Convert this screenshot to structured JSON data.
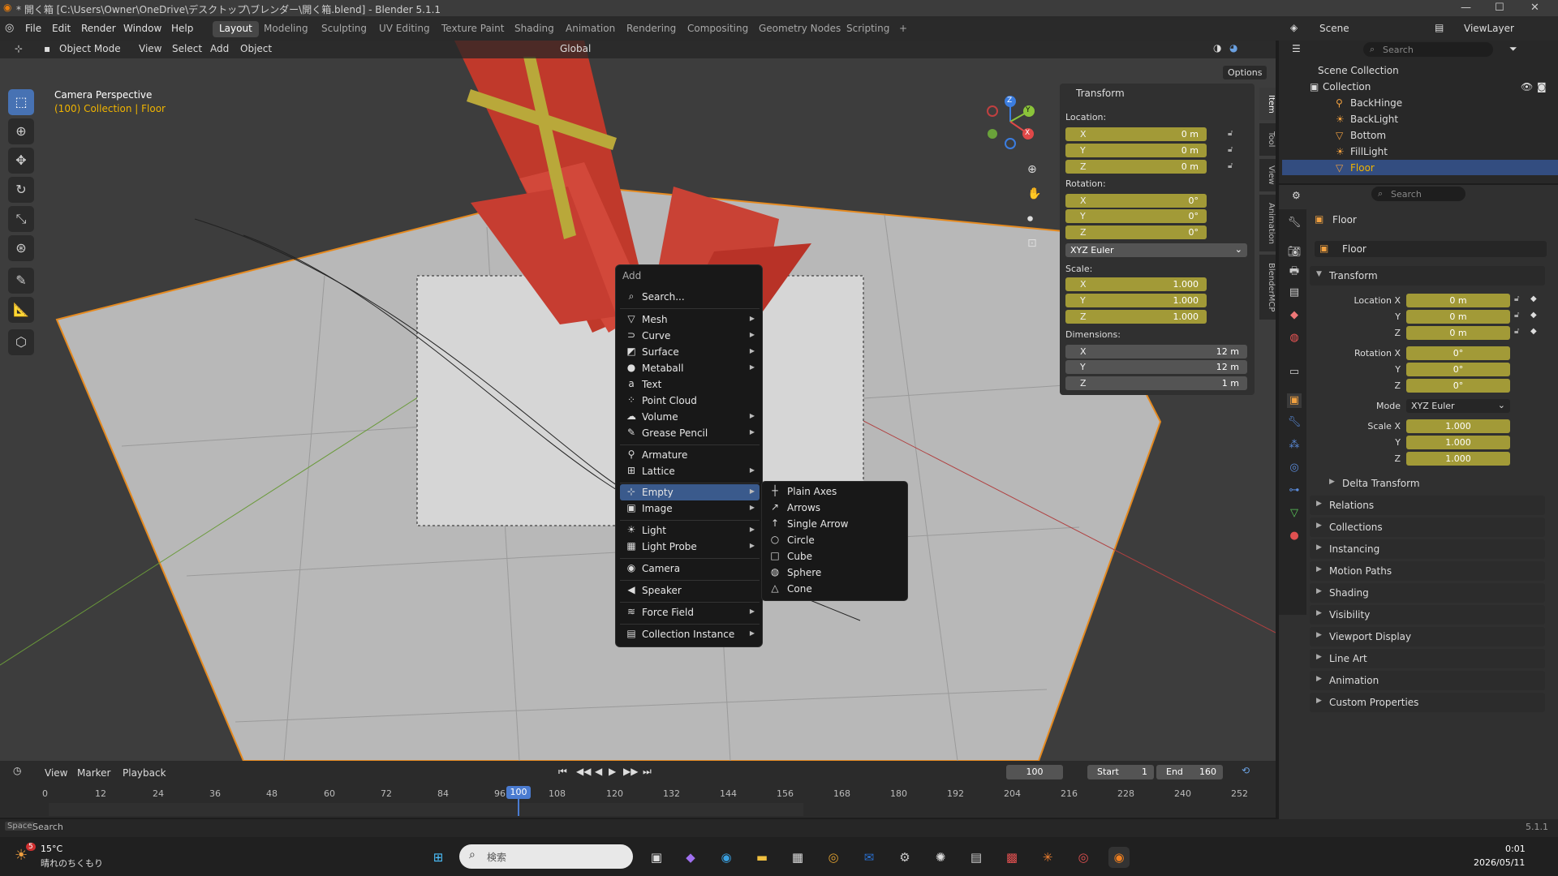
{
  "window": {
    "title": "* 開く箱 [C:\\Users\\Owner\\OneDrive\\デスクトップ\\ブレンダー\\開く箱.blend] - Blender 5.1.1",
    "minimize": "—",
    "maximize": "☐",
    "close": "✕"
  },
  "menubar": {
    "items": [
      "File",
      "Edit",
      "Render",
      "Window",
      "Help"
    ]
  },
  "workspaces": {
    "tabs": [
      "Layout",
      "Modeling",
      "Sculpting",
      "UV Editing",
      "Texture Paint",
      "Shading",
      "Animation",
      "Rendering",
      "Compositing",
      "Geometry Nodes",
      "Scripting"
    ],
    "active": "Layout",
    "add": "+"
  },
  "scene": {
    "label": "Scene",
    "viewlayer": "ViewLayer"
  },
  "viewport": {
    "mode": "Object Mode",
    "menus": [
      "View",
      "Select",
      "Add",
      "Object"
    ],
    "orientation": "Global",
    "options": "Options",
    "camera_title": "Camera Perspective",
    "collection_info": "(100) Collection | Floor",
    "gizmo": {
      "x": "X",
      "y": "Y",
      "z": "Z"
    }
  },
  "npanel": {
    "header": "Transform",
    "location_label": "Location:",
    "location": [
      {
        "axis": "X",
        "value": "0 m"
      },
      {
        "axis": "Y",
        "value": "0 m"
      },
      {
        "axis": "Z",
        "value": "0 m"
      }
    ],
    "rotation_label": "Rotation:",
    "rotation": [
      {
        "axis": "X",
        "value": "0°"
      },
      {
        "axis": "Y",
        "value": "0°"
      },
      {
        "axis": "Z",
        "value": "0°"
      }
    ],
    "rotation_mode": "XYZ Euler",
    "scale_label": "Scale:",
    "scale": [
      {
        "axis": "X",
        "value": "1.000"
      },
      {
        "axis": "Y",
        "value": "1.000"
      },
      {
        "axis": "Z",
        "value": "1.000"
      }
    ],
    "dimensions_label": "Dimensions:",
    "dimensions": [
      {
        "axis": "X",
        "value": "12 m"
      },
      {
        "axis": "Y",
        "value": "12 m"
      },
      {
        "axis": "Z",
        "value": "1 m"
      }
    ],
    "tabs": [
      "Item",
      "Tool",
      "View",
      "Animation",
      "BlenderMCP"
    ]
  },
  "add_menu": {
    "title": "Add",
    "search": "Search...",
    "items": [
      {
        "label": "Mesh",
        "icon": "▽",
        "sub": true
      },
      {
        "label": "Curve",
        "icon": "⊃",
        "sub": true
      },
      {
        "label": "Surface",
        "icon": "◩",
        "sub": true
      },
      {
        "label": "Metaball",
        "icon": "●",
        "sub": true
      },
      {
        "label": "Text",
        "icon": "a",
        "sub": false
      },
      {
        "label": "Point Cloud",
        "icon": "⁘",
        "sub": false
      },
      {
        "label": "Volume",
        "icon": "☁",
        "sub": true
      },
      {
        "label": "Grease Pencil",
        "icon": "✎",
        "sub": true
      },
      {
        "label": "Armature",
        "icon": "⚲",
        "sub": false
      },
      {
        "label": "Lattice",
        "icon": "⊞",
        "sub": true
      },
      {
        "label": "Empty",
        "icon": "⊹",
        "sub": true
      },
      {
        "label": "Image",
        "icon": "▣",
        "sub": true
      },
      {
        "label": "Light",
        "icon": "☀",
        "sub": true
      },
      {
        "label": "Light Probe",
        "icon": "▦",
        "sub": true
      },
      {
        "label": "Camera",
        "icon": "◉",
        "sub": false
      },
      {
        "label": "Speaker",
        "icon": "◀",
        "sub": false
      },
      {
        "label": "Force Field",
        "icon": "≋",
        "sub": true
      },
      {
        "label": "Collection Instance",
        "icon": "▤",
        "sub": true
      }
    ],
    "highlighted": "Empty"
  },
  "empty_submenu": {
    "items": [
      {
        "label": "Plain Axes",
        "icon": "┼"
      },
      {
        "label": "Arrows",
        "icon": "↗"
      },
      {
        "label": "Single Arrow",
        "icon": "↑"
      },
      {
        "label": "Circle",
        "icon": "○"
      },
      {
        "label": "Cube",
        "icon": "□"
      },
      {
        "label": "Sphere",
        "icon": "◍"
      },
      {
        "label": "Cone",
        "icon": "△"
      }
    ]
  },
  "outliner": {
    "search": "Search",
    "root": "Scene Collection",
    "collection": "Collection",
    "items": [
      "BackHinge",
      "BackLight",
      "Bottom",
      "FillLight",
      "Floor"
    ],
    "selected": "Floor"
  },
  "properties": {
    "search": "Search",
    "object_name": "Floor",
    "data_name": "Floor",
    "transform_header": "Transform",
    "rows": [
      {
        "label": "Location X",
        "value": "0 m"
      },
      {
        "label": "Y",
        "value": "0 m"
      },
      {
        "label": "Z",
        "value": "0 m"
      },
      {
        "label": "Rotation X",
        "value": "0°"
      },
      {
        "label": "Y",
        "value": "0°"
      },
      {
        "label": "Z",
        "value": "0°"
      },
      {
        "label": "Scale X",
        "value": "1.000"
      },
      {
        "label": "Y",
        "value": "1.000"
      },
      {
        "label": "Z",
        "value": "1.000"
      }
    ],
    "mode_label": "Mode",
    "mode_value": "XYZ Euler",
    "delta": "Delta Transform",
    "sections": [
      "Relations",
      "Collections",
      "Instancing",
      "Motion Paths",
      "Shading",
      "Visibility",
      "Viewport Display",
      "Line Art",
      "Animation",
      "Custom Properties"
    ]
  },
  "timeline": {
    "menus": [
      "View",
      "Marker",
      "Playback"
    ],
    "current_frame": "100",
    "start_label": "Start",
    "start": "1",
    "end_label": "End",
    "end": "160",
    "ticks": [
      "0",
      "12",
      "24",
      "36",
      "48",
      "60",
      "72",
      "84",
      "96",
      "108",
      "120",
      "132",
      "144",
      "156",
      "168",
      "180",
      "192",
      "204",
      "216",
      "228",
      "240",
      "252"
    ],
    "playhead": "100"
  },
  "statusbar": {
    "key": "Space",
    "action": "Search",
    "version": "5.1.1"
  },
  "taskbar": {
    "weather_temp": "15°C",
    "weather_desc": "晴れのちくもり",
    "weather_badge": "5",
    "search": "検索",
    "time": "0:01",
    "date": "2026/05/11"
  }
}
